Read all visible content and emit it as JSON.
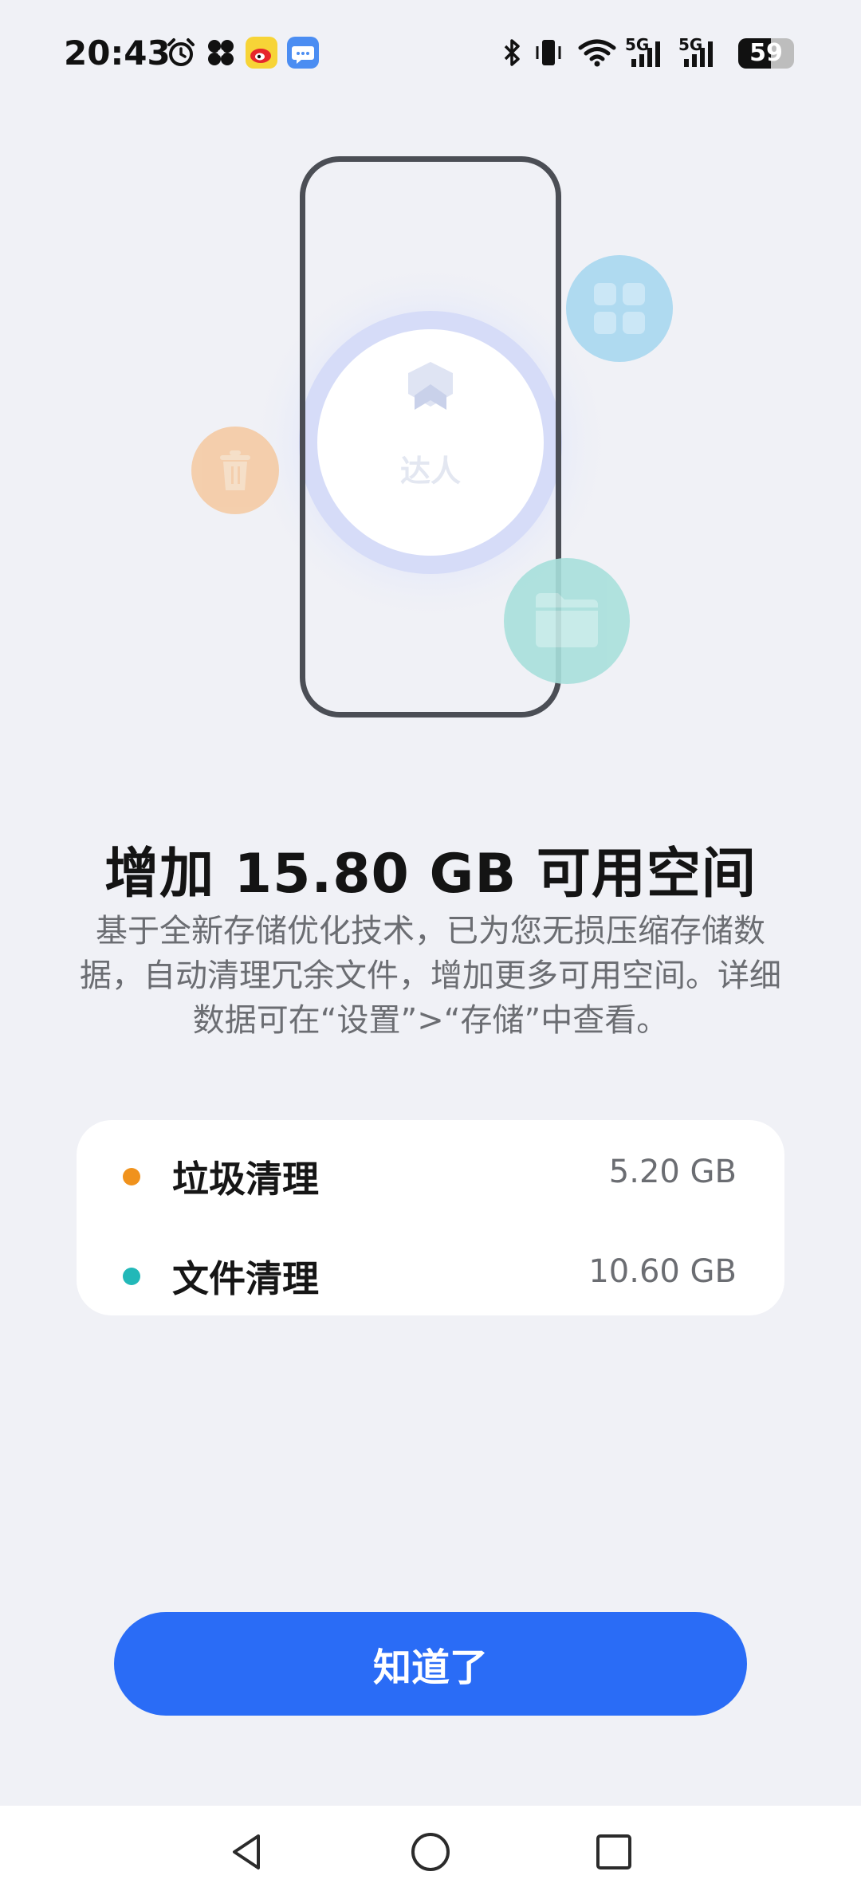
{
  "status_bar": {
    "time": "20:43",
    "network_left": "5G",
    "network_right": "5G",
    "battery": "59",
    "icons": [
      "alarm-icon",
      "pinwheel-icon",
      "weibo-icon",
      "message-icon",
      "bluetooth-icon",
      "vibrate-icon",
      "wifi-icon",
      "signal-icon",
      "battery-icon"
    ]
  },
  "hero": {
    "badge_text": "达人",
    "icons": [
      "trash-icon",
      "apps-grid-icon",
      "folder-icon",
      "shield-badge-icon"
    ],
    "colors": {
      "trash": "#f5c9a0",
      "apps": "#a9d8f0",
      "folder": "#a8e0dc",
      "ring": "#c9d2f5"
    }
  },
  "headline": "增加 15.80 GB 可用空间",
  "description": "基于全新存储优化技术，已为您无损压缩存储数据，自动清理冗余文件，增加更多可用空间。详细数据可在“设置”>“存储”中查看。",
  "summary": {
    "items": [
      {
        "label": "垃圾清理",
        "value": "5.20 GB",
        "dot_color": "#f0921c"
      },
      {
        "label": "文件清理",
        "value": "10.60 GB",
        "dot_color": "#22b8b8"
      }
    ]
  },
  "primary_button": {
    "label": "知道了",
    "color": "#2a6cf6"
  },
  "nav": {
    "items": [
      "back-icon",
      "home-icon",
      "recents-icon"
    ]
  }
}
